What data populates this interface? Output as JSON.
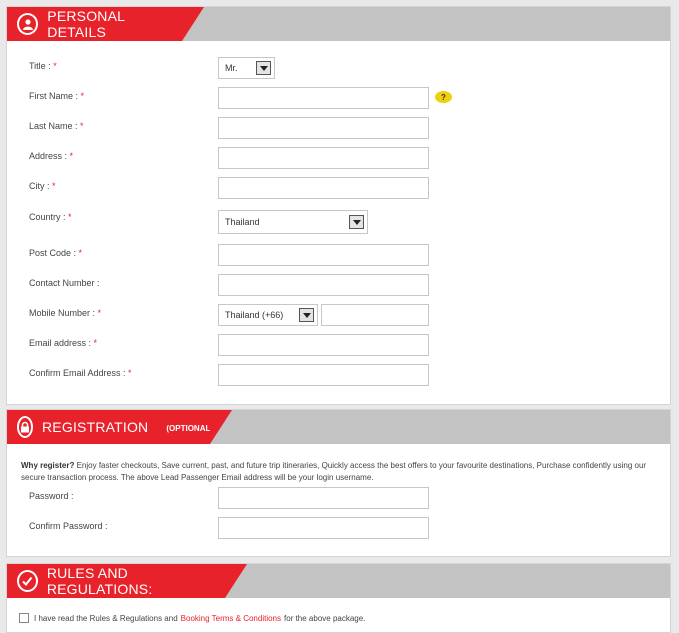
{
  "personal": {
    "title": "PERSONAL DETAILS",
    "icon": "user-icon",
    "fields": {
      "title": {
        "label": "Title :",
        "value": "Mr."
      },
      "first_name": {
        "label": "First Name :",
        "value": "",
        "help": "?"
      },
      "last_name": {
        "label": "Last Name :",
        "value": ""
      },
      "address": {
        "label": "Address :",
        "value": ""
      },
      "city": {
        "label": "City :",
        "value": ""
      },
      "country": {
        "label": "Country :",
        "value": "Thailand"
      },
      "post_code": {
        "label": "Post Code :",
        "value": ""
      },
      "contact_number": {
        "label": "Contact Number :",
        "value": ""
      },
      "mobile_number": {
        "label": "Mobile Number :",
        "code": "Thailand (+66)",
        "value": ""
      },
      "email": {
        "label": "Email address :",
        "value": ""
      },
      "confirm_email": {
        "label": "Confirm Email Address :",
        "value": ""
      }
    },
    "required_mark": "*"
  },
  "registration": {
    "title": "REGISTRATION",
    "optional": "(OPTIONAL)",
    "icon": "lock-icon",
    "why_title": "Why register?",
    "why_text": "Enjoy faster checkouts, Save current, past, and future trip itineraries, Quickly access the best offers to your favourite destinations, Purchase confidently using our secure transaction process. The above Lead Passenger Email address will be your login username.",
    "password_label": "Password :",
    "confirm_password_label": "Confirm Password :"
  },
  "rules": {
    "title": "RULES AND REGULATIONS:",
    "icon": "checkmark-icon",
    "agree_prefix": "I have read the Rules & Regulations and",
    "agree_link": "Booking Terms & Conditions",
    "agree_suffix": "for the above package."
  },
  "colors": {
    "accent": "#e8222b",
    "header_gray": "#c3c3c3",
    "help_yellow": "#f0cf0e"
  }
}
